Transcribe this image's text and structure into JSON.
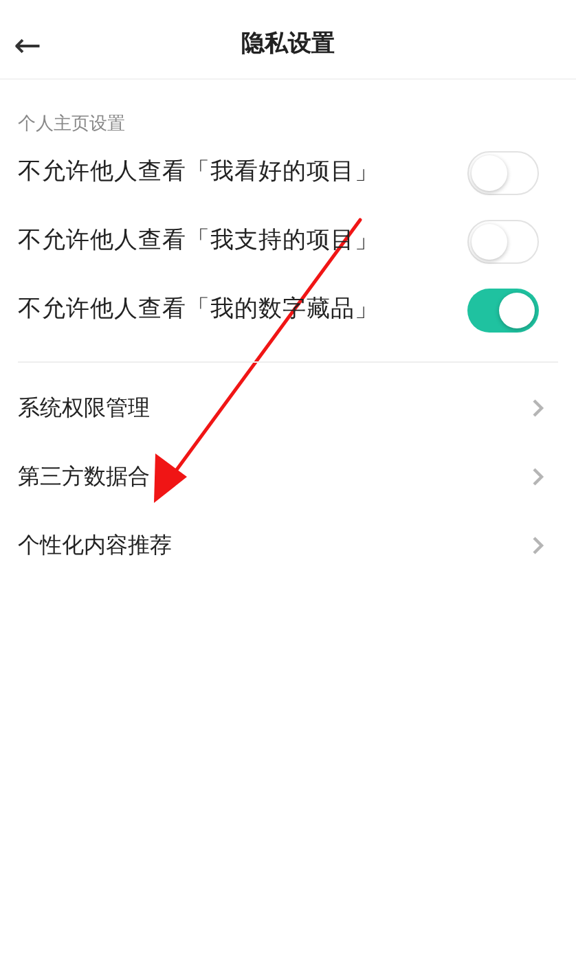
{
  "header": {
    "back": "←",
    "title": "隐私设置"
  },
  "profile_section": {
    "label": "个人主页设置",
    "toggles": [
      {
        "label": "不允许他人查看「我看好的项目」",
        "on": false
      },
      {
        "label": "不允许他人查看「我支持的项目」",
        "on": false
      },
      {
        "label": "不允许他人查看「我的数字藏品」",
        "on": true
      }
    ]
  },
  "menu": [
    {
      "label": "系统权限管理"
    },
    {
      "label": "第三方数据合"
    },
    {
      "label": "个性化内容推荐"
    }
  ],
  "annotation": {
    "kind": "arrow"
  }
}
